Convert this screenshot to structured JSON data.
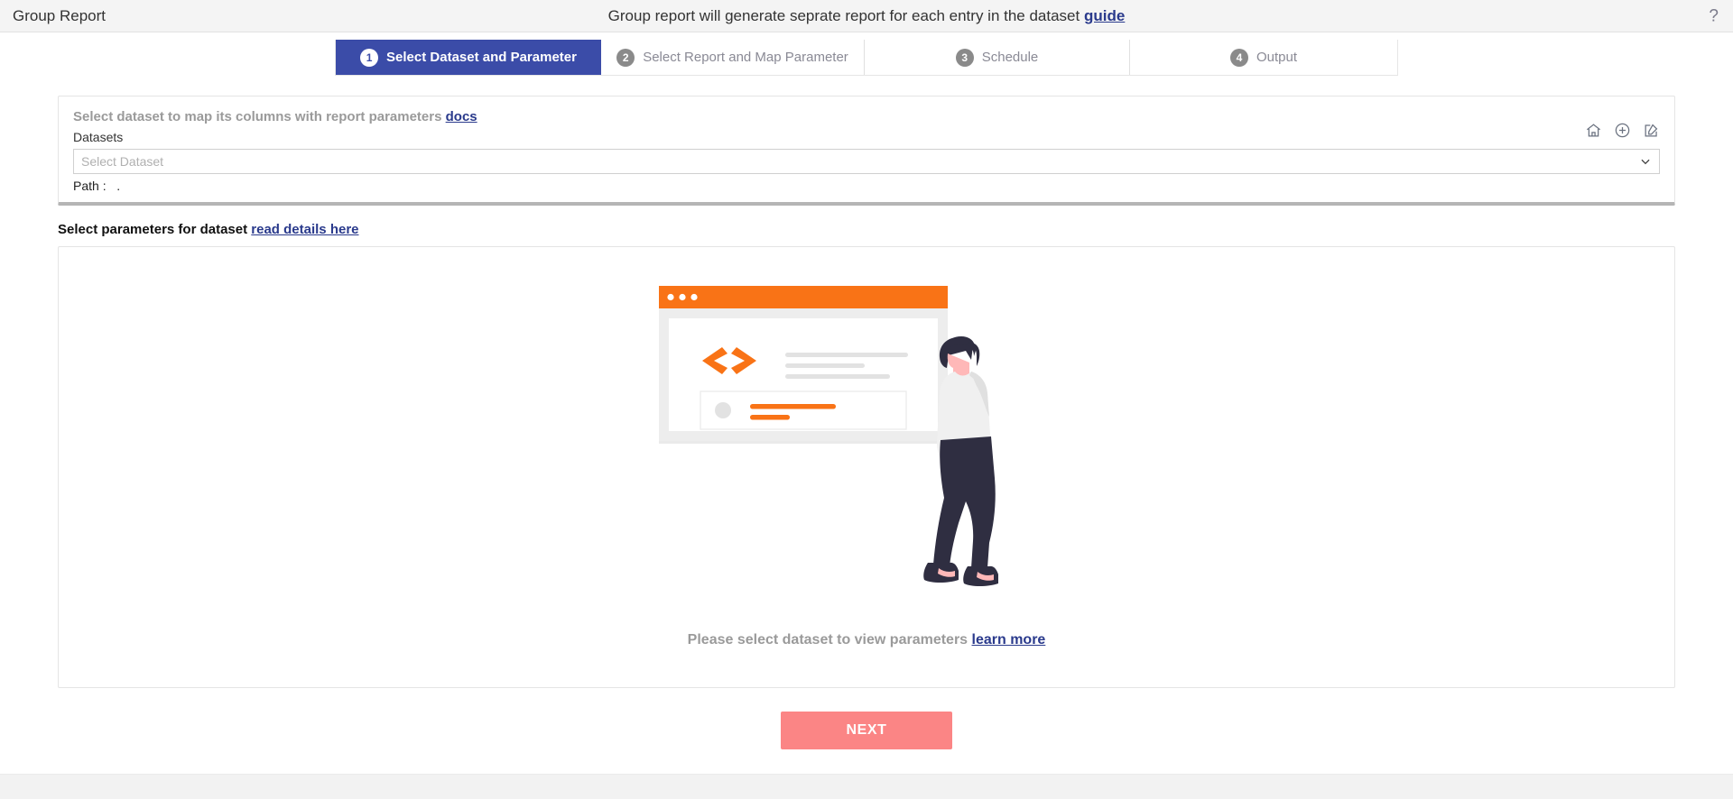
{
  "topbar": {
    "title": "Group Report",
    "notice_text": "Group report will generate seprate report for each entry in the dataset",
    "notice_link": "guide",
    "help_icon": "question-mark-icon"
  },
  "stepper": {
    "steps": [
      {
        "num": "1",
        "label": "Select Dataset and Parameter",
        "active": true
      },
      {
        "num": "2",
        "label": "Select Report and Map Parameter",
        "active": false
      },
      {
        "num": "3",
        "label": "Schedule",
        "active": false
      },
      {
        "num": "4",
        "label": "Output",
        "active": false
      }
    ]
  },
  "dataset_panel": {
    "heading": "Select dataset to map its columns with report parameters",
    "heading_link": "docs",
    "field_label": "Datasets",
    "select_placeholder": "Select Dataset",
    "path_label": "Path :",
    "path_value": ".",
    "icons": [
      "home-icon",
      "plus-circle-icon",
      "edit-square-icon"
    ]
  },
  "parameters": {
    "title": "Select parameters for dataset",
    "title_link": "read details here",
    "empty_message": "Please select dataset to view parameters",
    "empty_link": "learn more"
  },
  "footer": {
    "next_label": "NEXT"
  },
  "colors": {
    "active_step": "#3b4ca8",
    "next_button": "#fb8585",
    "link": "#2a3a8c",
    "illustration_accent": "#f97316"
  }
}
